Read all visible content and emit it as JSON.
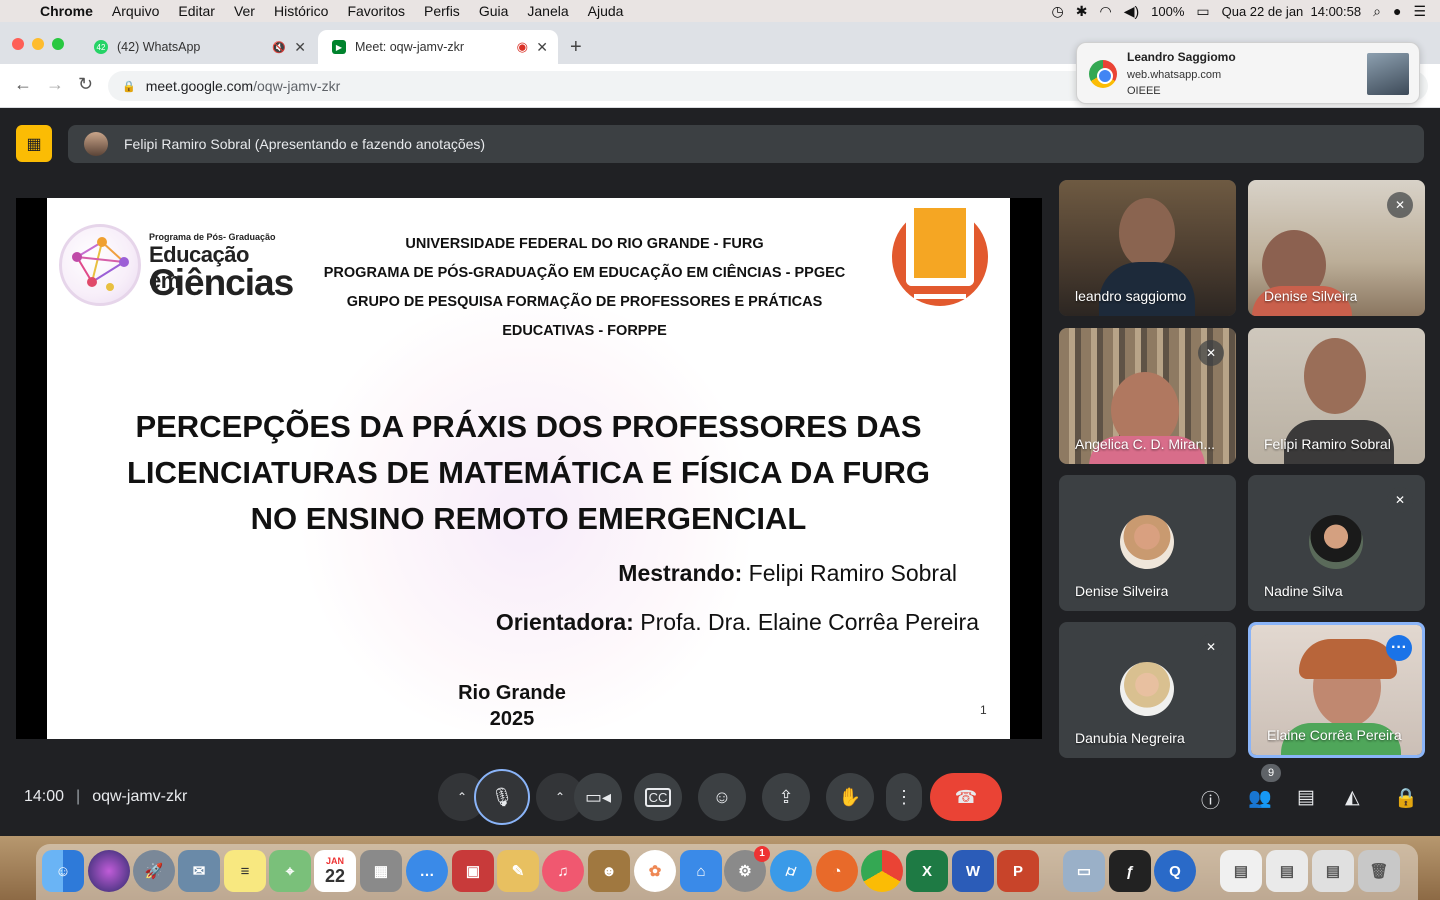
{
  "menubar": {
    "app": "Chrome",
    "items": [
      "Arquivo",
      "Editar",
      "Ver",
      "Histórico",
      "Favoritos",
      "Perfis",
      "Guia",
      "Janela",
      "Ajuda"
    ],
    "battery": "100%",
    "datetime": "Qua 22 de jan  14:00:58"
  },
  "tabs": [
    {
      "title": "(42) WhatsApp",
      "badge": "42"
    },
    {
      "title": "Meet: oqw-jamv-zkr"
    }
  ],
  "omnibox": {
    "host": "meet.google.com",
    "path": "/oqw-jamv-zkr"
  },
  "notification": {
    "sender": "Leandro Saggiomo",
    "site": "web.whatsapp.com",
    "message": "OIEEE"
  },
  "presenter": {
    "label": "Felipi Ramiro Sobral (Apresentando e fazendo anotações)"
  },
  "slide": {
    "logo_left_small": "Programa de Pós- Graduação",
    "logo_left_l2": "Educação em",
    "logo_left_l3": "Ciências",
    "header": [
      "UNIVERSIDADE FEDERAL DO RIO GRANDE - FURG",
      "PROGRAMA DE PÓS-GRADUAÇÃO EM EDUCAÇÃO EM CIÊNCIAS - PPGEC",
      "GRUPO DE PESQUISA FORMAÇÃO DE PROFESSORES E PRÁTICAS",
      "EDUCATIVAS - FORPPE"
    ],
    "title_lines": [
      "PERCEPÇÕES DA PRÁXIS DOS PROFESSORES DAS",
      "LICENCIATURAS DE MATEMÁTICA E FÍSICA DA FURG",
      "NO ENSINO REMOTO EMERGENCIAL"
    ],
    "mestrando_label": "Mestrando:",
    "mestrando_name": " Felipi Ramiro Sobral",
    "orientadora_label": "Orientadora:",
    "orientadora_name": " Profa. Dra. Elaine Corrêa Pereira",
    "city": "Rio Grande",
    "year": "2025",
    "page": "1"
  },
  "participants": [
    {
      "name": "leandro saggiomo",
      "muted": false
    },
    {
      "name": "Denise Silveira",
      "muted": true
    },
    {
      "name": "Angelica C. D. Miran...",
      "muted": true
    },
    {
      "name": "Felipi Ramiro Sobral",
      "muted": false
    },
    {
      "name": "Denise Silveira",
      "muted": false
    },
    {
      "name": "Nadine Silva",
      "muted": true
    },
    {
      "name": "Danubia Negreira",
      "muted": true
    },
    {
      "name": "Elaine Corrêa Pereira",
      "muted": false
    }
  ],
  "meeting": {
    "time": "14:00",
    "code": "oqw-jamv-zkr",
    "participant_count": "9"
  },
  "dock": {
    "calendar_month": "JAN",
    "calendar_day": "22",
    "settings_badge": "1"
  }
}
